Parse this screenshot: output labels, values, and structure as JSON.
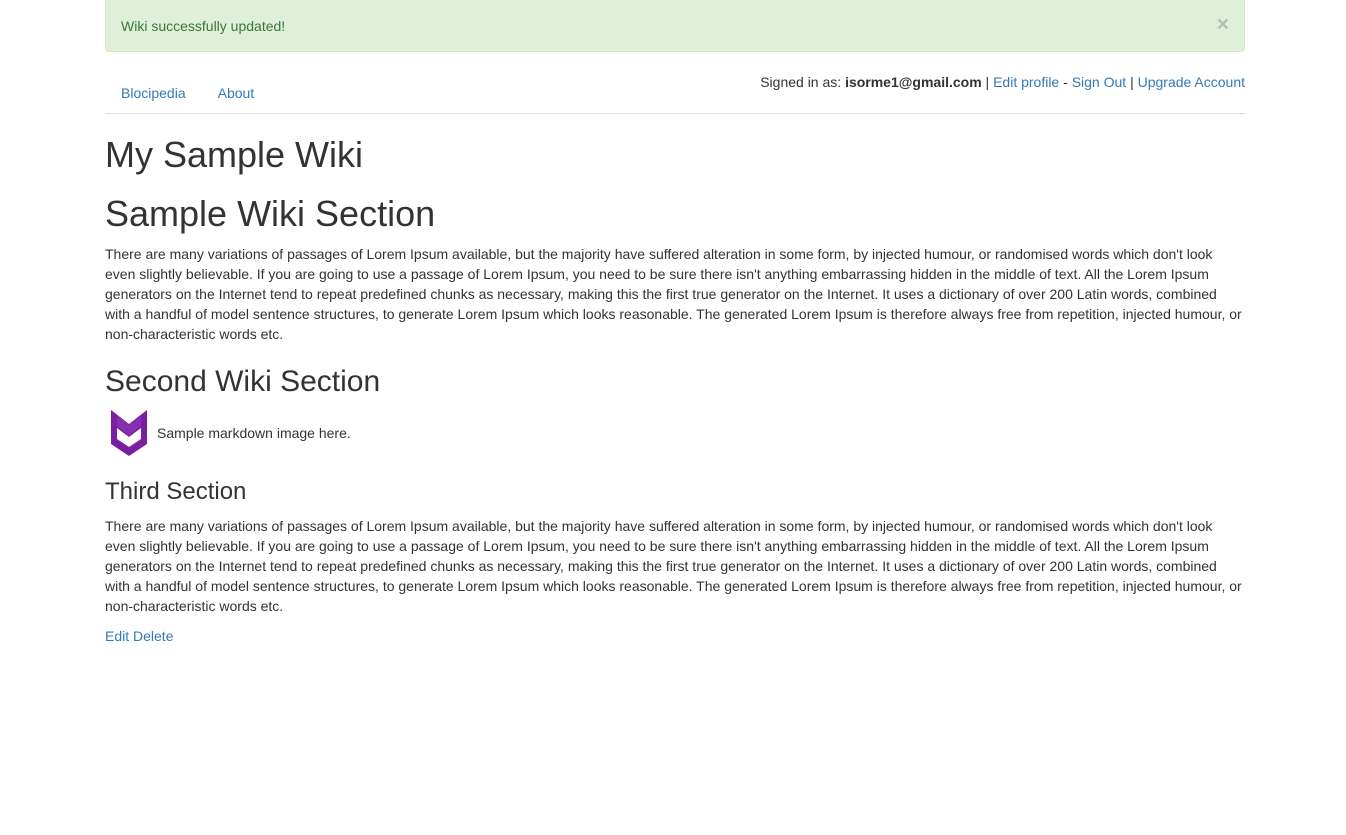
{
  "alert": {
    "message": "Wiki successfully updated!",
    "close": "×"
  },
  "nav": {
    "items": [
      {
        "label": "Blocipedia"
      },
      {
        "label": "About"
      }
    ]
  },
  "user": {
    "signed_in_prefix": "Signed in as:",
    "email": "isorme1@gmail.com",
    "sep1": "|",
    "edit_profile": "Edit profile",
    "sep2": "-",
    "sign_out": "Sign Out",
    "sep3": "|",
    "upgrade": "Upgrade Account"
  },
  "wiki": {
    "title": "My Sample Wiki",
    "section1_title": "Sample Wiki Section",
    "section1_body": "There are many variations of passages of Lorem Ipsum available, but the majority have suffered alteration in some form, by injected humour, or randomised words which don't look even slightly believable. If you are going to use a passage of Lorem Ipsum, you need to be sure there isn't anything embarrassing hidden in the middle of text. All the Lorem Ipsum generators on the Internet tend to repeat predefined chunks as necessary, making this the first true generator on the Internet. It uses a dictionary of over 200 Latin words, combined with a handful of model sentence structures, to generate Lorem Ipsum which looks reasonable. The generated Lorem Ipsum is therefore always free from repetition, injected humour, or non-characteristic words etc.",
    "section2_title": "Second Wiki Section",
    "image_caption": "Sample markdown image here.",
    "image_icon": "markdown-logo-icon",
    "image_color": "#7b1fa2",
    "section3_title": "Third Section",
    "section3_body": "There are many variations of passages of Lorem Ipsum available, but the majority have suffered alteration in some form, by injected humour, or randomised words which don't look even slightly believable. If you are going to use a passage of Lorem Ipsum, you need to be sure there isn't anything embarrassing hidden in the middle of text. All the Lorem Ipsum generators on the Internet tend to repeat predefined chunks as necessary, making this the first true generator on the Internet. It uses a dictionary of over 200 Latin words, combined with a handful of model sentence structures, to generate Lorem Ipsum which looks reasonable. The generated Lorem Ipsum is therefore always free from repetition, injected humour, or non-characteristic words etc."
  },
  "actions": {
    "edit": "Edit",
    "delete": "Delete"
  },
  "colors": {
    "link": "#337ab7",
    "alert_bg": "#dff0d8",
    "alert_text": "#3c763d"
  }
}
